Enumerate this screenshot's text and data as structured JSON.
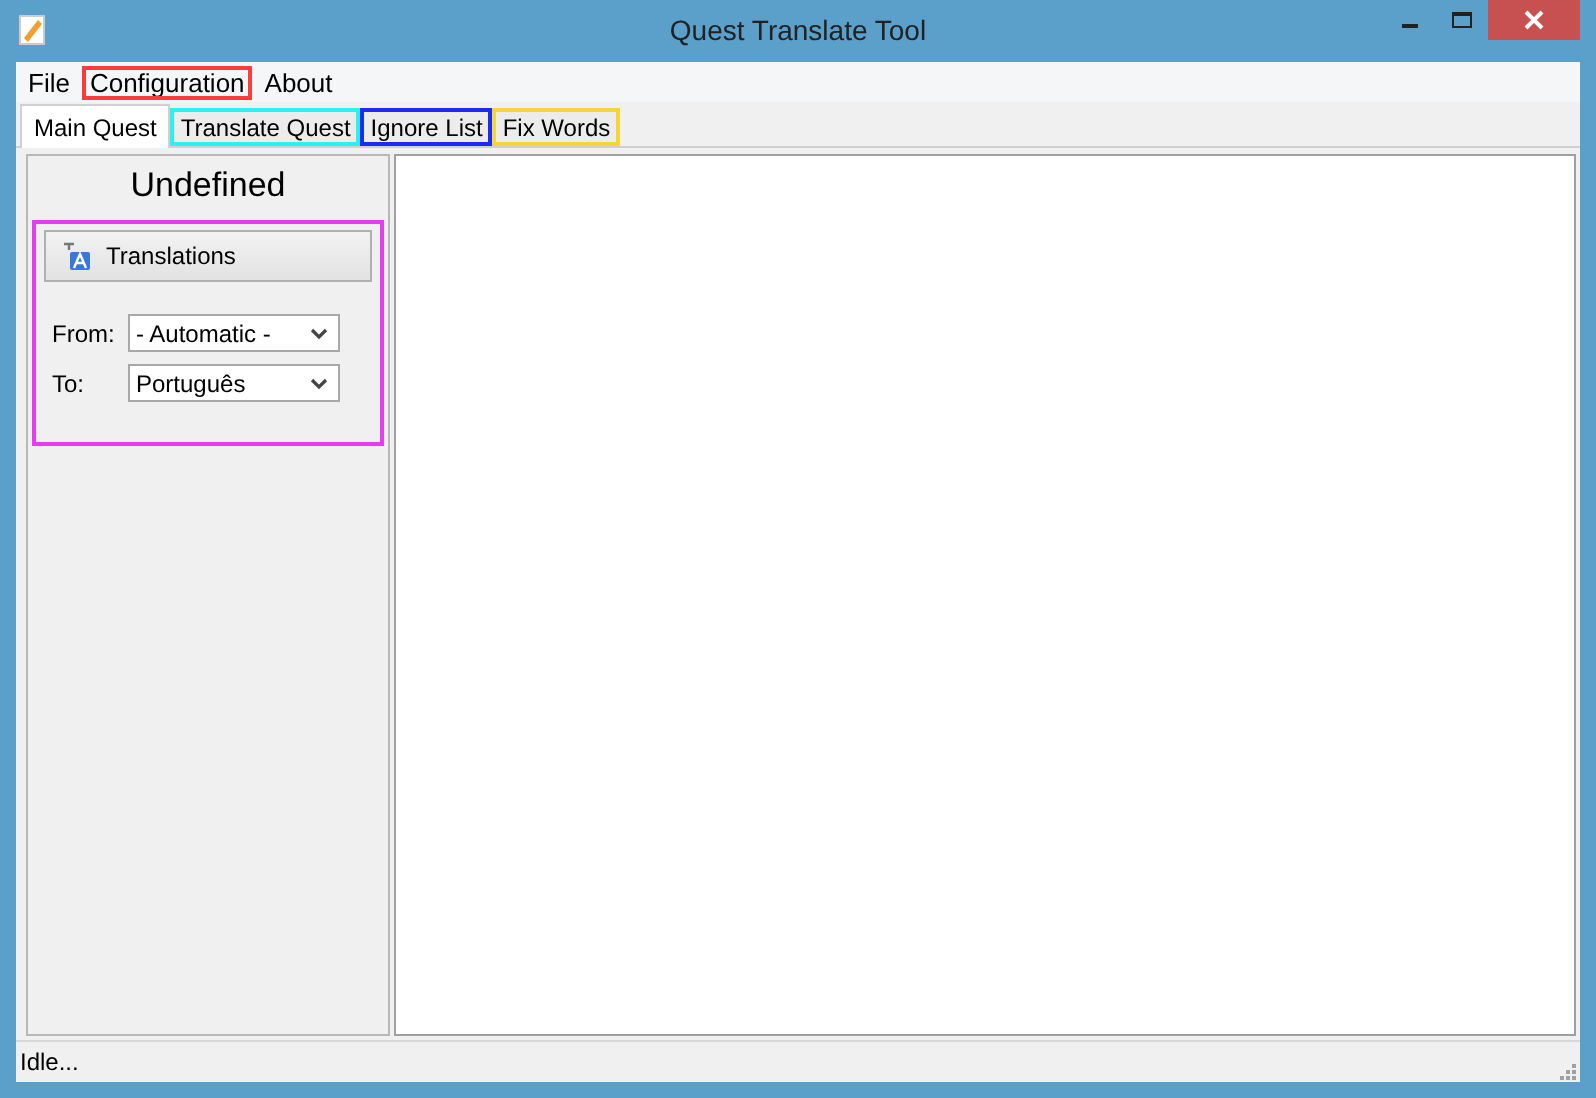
{
  "window": {
    "title": "Quest Translate Tool"
  },
  "menu": [
    {
      "label": "File"
    },
    {
      "label": "Configuration",
      "color": "#ff3b3b"
    },
    {
      "label": "About"
    }
  ],
  "tabs": [
    {
      "label": "Main Quest",
      "selected": true
    },
    {
      "label": "Translate Quest",
      "selected": false,
      "color": "#2ff0f0"
    },
    {
      "label": "Ignore List",
      "selected": false,
      "color": "#1a2cf0"
    },
    {
      "label": "Fix Words",
      "selected": false,
      "color": "#f5d63a"
    }
  ],
  "panel": {
    "heading": "Undefined",
    "color": "#e83cf0",
    "button": "Translations",
    "fields": [
      {
        "label": "From:",
        "value": "- Automatic -"
      },
      {
        "label": "To:",
        "value": "Português"
      }
    ]
  },
  "status_bar": "Idle..."
}
